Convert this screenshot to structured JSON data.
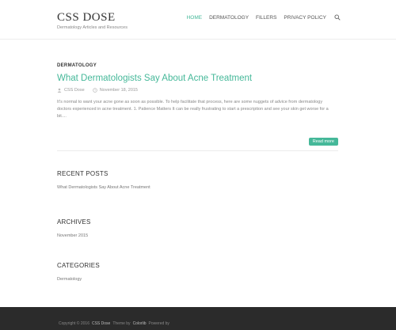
{
  "site": {
    "title": "CSS DOSE",
    "description": "Dermatology Articles and Resources"
  },
  "nav": {
    "items": [
      "HOME",
      "DERMATOLOGY",
      "FILLERS",
      "PRIVACY POLICY"
    ],
    "active": "HOME",
    "search_icon": "search-icon"
  },
  "post": {
    "category": "DERMATOLOGY",
    "title": "What Dermatologists Say About Acne Treatment",
    "author": "CSS Dose",
    "date": "November 18, 2015",
    "excerpt": "It's normal to want your acne gone as soon as possible. To help facilitate that process, here are some nuggets of advice from dermatology doctors experienced in acne treatment. 1. Patience Matters It can be really frustrating to start a prescription and see your skin get worse for a bit....",
    "read_more": "Read more"
  },
  "widgets": {
    "recent_posts": {
      "title": "RECENT POSTS",
      "items": [
        "What Dermatologists Say About Acne Treatment"
      ]
    },
    "archives": {
      "title": "ARCHIVES",
      "items": [
        "November 2015"
      ]
    },
    "categories": {
      "title": "CATEGORIES",
      "items": [
        "Dermatology"
      ]
    }
  },
  "footer": {
    "copyright": "Copyright © 2016",
    "site": "CSS Dose",
    "theme_prefix": "Theme by",
    "theme": "Colorlib",
    "powered": "Powered by"
  },
  "colors": {
    "accent": "#45b899",
    "footer_bg": "#2b2b2b"
  }
}
